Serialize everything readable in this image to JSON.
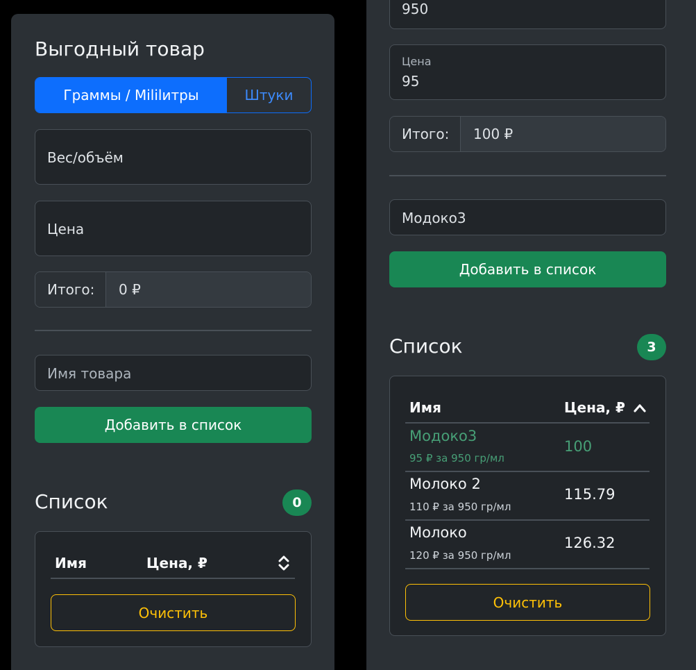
{
  "left": {
    "title": "Выгодный товар",
    "mode_tabs": [
      "Граммы / Мililитры",
      "Штуки"
    ],
    "weight_placeholder": "Вес/объём",
    "price_placeholder": "Цена",
    "total_label": "Итого:",
    "total_value": "0 ₽",
    "name_placeholder": "Имя товара",
    "add_button": "Добавить в список",
    "list_title": "Список",
    "list_count": "0",
    "col_name": "Имя",
    "col_price": "Цена, ₽",
    "clear_button": "Очистить"
  },
  "right": {
    "weight_value": "950",
    "price_label": "Цена",
    "price_value": "95",
    "total_label": "Итого:",
    "total_value": "100 ₽",
    "name_value": "Модоко3",
    "add_button": "Добавить в список",
    "list_title": "Список",
    "list_count": "3",
    "col_name": "Имя",
    "col_price": "Цена, ₽",
    "items": [
      {
        "name": "Модоко3",
        "detail": "95 ₽ за 950 гр/мл",
        "price": "100",
        "best": true
      },
      {
        "name": "Молоко 2",
        "detail": "110 ₽ за 950 гр/мл",
        "price": "115.79",
        "best": false
      },
      {
        "name": "Молоко",
        "detail": "120 ₽ за 950 гр/мл",
        "price": "126.32",
        "best": false
      }
    ],
    "clear_button": "Очистить"
  },
  "colors": {
    "primary": "#0d6efd",
    "success": "#198754",
    "best_text": "#479f76",
    "warning": "#ffc107",
    "panel_bg": "#2b3035",
    "input_bg": "#212529"
  },
  "icons": {
    "sort_both": "sort-icon",
    "sort_up": "chevron-up-icon"
  }
}
